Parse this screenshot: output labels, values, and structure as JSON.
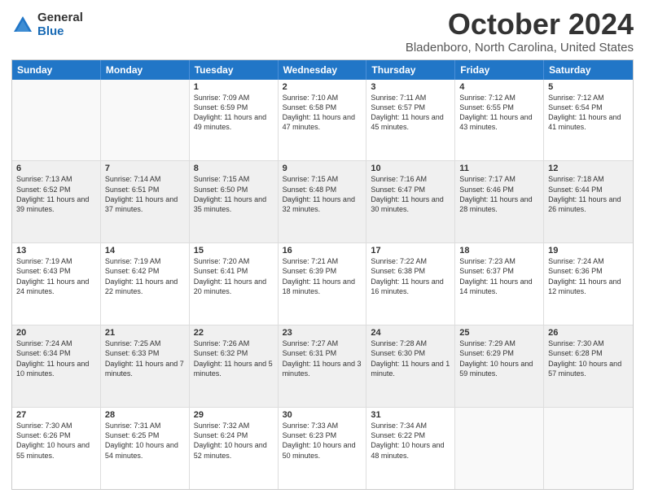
{
  "logo": {
    "general": "General",
    "blue": "Blue"
  },
  "title": {
    "month": "October 2024",
    "location": "Bladenboro, North Carolina, United States"
  },
  "header_days": [
    "Sunday",
    "Monday",
    "Tuesday",
    "Wednesday",
    "Thursday",
    "Friday",
    "Saturday"
  ],
  "rows": [
    [
      {
        "day": "",
        "text": "",
        "empty": true
      },
      {
        "day": "",
        "text": "",
        "empty": true
      },
      {
        "day": "1",
        "text": "Sunrise: 7:09 AM\nSunset: 6:59 PM\nDaylight: 11 hours and 49 minutes."
      },
      {
        "day": "2",
        "text": "Sunrise: 7:10 AM\nSunset: 6:58 PM\nDaylight: 11 hours and 47 minutes."
      },
      {
        "day": "3",
        "text": "Sunrise: 7:11 AM\nSunset: 6:57 PM\nDaylight: 11 hours and 45 minutes."
      },
      {
        "day": "4",
        "text": "Sunrise: 7:12 AM\nSunset: 6:55 PM\nDaylight: 11 hours and 43 minutes."
      },
      {
        "day": "5",
        "text": "Sunrise: 7:12 AM\nSunset: 6:54 PM\nDaylight: 11 hours and 41 minutes."
      }
    ],
    [
      {
        "day": "6",
        "text": "Sunrise: 7:13 AM\nSunset: 6:52 PM\nDaylight: 11 hours and 39 minutes."
      },
      {
        "day": "7",
        "text": "Sunrise: 7:14 AM\nSunset: 6:51 PM\nDaylight: 11 hours and 37 minutes."
      },
      {
        "day": "8",
        "text": "Sunrise: 7:15 AM\nSunset: 6:50 PM\nDaylight: 11 hours and 35 minutes."
      },
      {
        "day": "9",
        "text": "Sunrise: 7:15 AM\nSunset: 6:48 PM\nDaylight: 11 hours and 32 minutes."
      },
      {
        "day": "10",
        "text": "Sunrise: 7:16 AM\nSunset: 6:47 PM\nDaylight: 11 hours and 30 minutes."
      },
      {
        "day": "11",
        "text": "Sunrise: 7:17 AM\nSunset: 6:46 PM\nDaylight: 11 hours and 28 minutes."
      },
      {
        "day": "12",
        "text": "Sunrise: 7:18 AM\nSunset: 6:44 PM\nDaylight: 11 hours and 26 minutes."
      }
    ],
    [
      {
        "day": "13",
        "text": "Sunrise: 7:19 AM\nSunset: 6:43 PM\nDaylight: 11 hours and 24 minutes."
      },
      {
        "day": "14",
        "text": "Sunrise: 7:19 AM\nSunset: 6:42 PM\nDaylight: 11 hours and 22 minutes."
      },
      {
        "day": "15",
        "text": "Sunrise: 7:20 AM\nSunset: 6:41 PM\nDaylight: 11 hours and 20 minutes."
      },
      {
        "day": "16",
        "text": "Sunrise: 7:21 AM\nSunset: 6:39 PM\nDaylight: 11 hours and 18 minutes."
      },
      {
        "day": "17",
        "text": "Sunrise: 7:22 AM\nSunset: 6:38 PM\nDaylight: 11 hours and 16 minutes."
      },
      {
        "day": "18",
        "text": "Sunrise: 7:23 AM\nSunset: 6:37 PM\nDaylight: 11 hours and 14 minutes."
      },
      {
        "day": "19",
        "text": "Sunrise: 7:24 AM\nSunset: 6:36 PM\nDaylight: 11 hours and 12 minutes."
      }
    ],
    [
      {
        "day": "20",
        "text": "Sunrise: 7:24 AM\nSunset: 6:34 PM\nDaylight: 11 hours and 10 minutes."
      },
      {
        "day": "21",
        "text": "Sunrise: 7:25 AM\nSunset: 6:33 PM\nDaylight: 11 hours and 7 minutes."
      },
      {
        "day": "22",
        "text": "Sunrise: 7:26 AM\nSunset: 6:32 PM\nDaylight: 11 hours and 5 minutes."
      },
      {
        "day": "23",
        "text": "Sunrise: 7:27 AM\nSunset: 6:31 PM\nDaylight: 11 hours and 3 minutes."
      },
      {
        "day": "24",
        "text": "Sunrise: 7:28 AM\nSunset: 6:30 PM\nDaylight: 11 hours and 1 minute."
      },
      {
        "day": "25",
        "text": "Sunrise: 7:29 AM\nSunset: 6:29 PM\nDaylight: 10 hours and 59 minutes."
      },
      {
        "day": "26",
        "text": "Sunrise: 7:30 AM\nSunset: 6:28 PM\nDaylight: 10 hours and 57 minutes."
      }
    ],
    [
      {
        "day": "27",
        "text": "Sunrise: 7:30 AM\nSunset: 6:26 PM\nDaylight: 10 hours and 55 minutes."
      },
      {
        "day": "28",
        "text": "Sunrise: 7:31 AM\nSunset: 6:25 PM\nDaylight: 10 hours and 54 minutes."
      },
      {
        "day": "29",
        "text": "Sunrise: 7:32 AM\nSunset: 6:24 PM\nDaylight: 10 hours and 52 minutes."
      },
      {
        "day": "30",
        "text": "Sunrise: 7:33 AM\nSunset: 6:23 PM\nDaylight: 10 hours and 50 minutes."
      },
      {
        "day": "31",
        "text": "Sunrise: 7:34 AM\nSunset: 6:22 PM\nDaylight: 10 hours and 48 minutes."
      },
      {
        "day": "",
        "text": "",
        "empty": true
      },
      {
        "day": "",
        "text": "",
        "empty": true
      }
    ]
  ]
}
